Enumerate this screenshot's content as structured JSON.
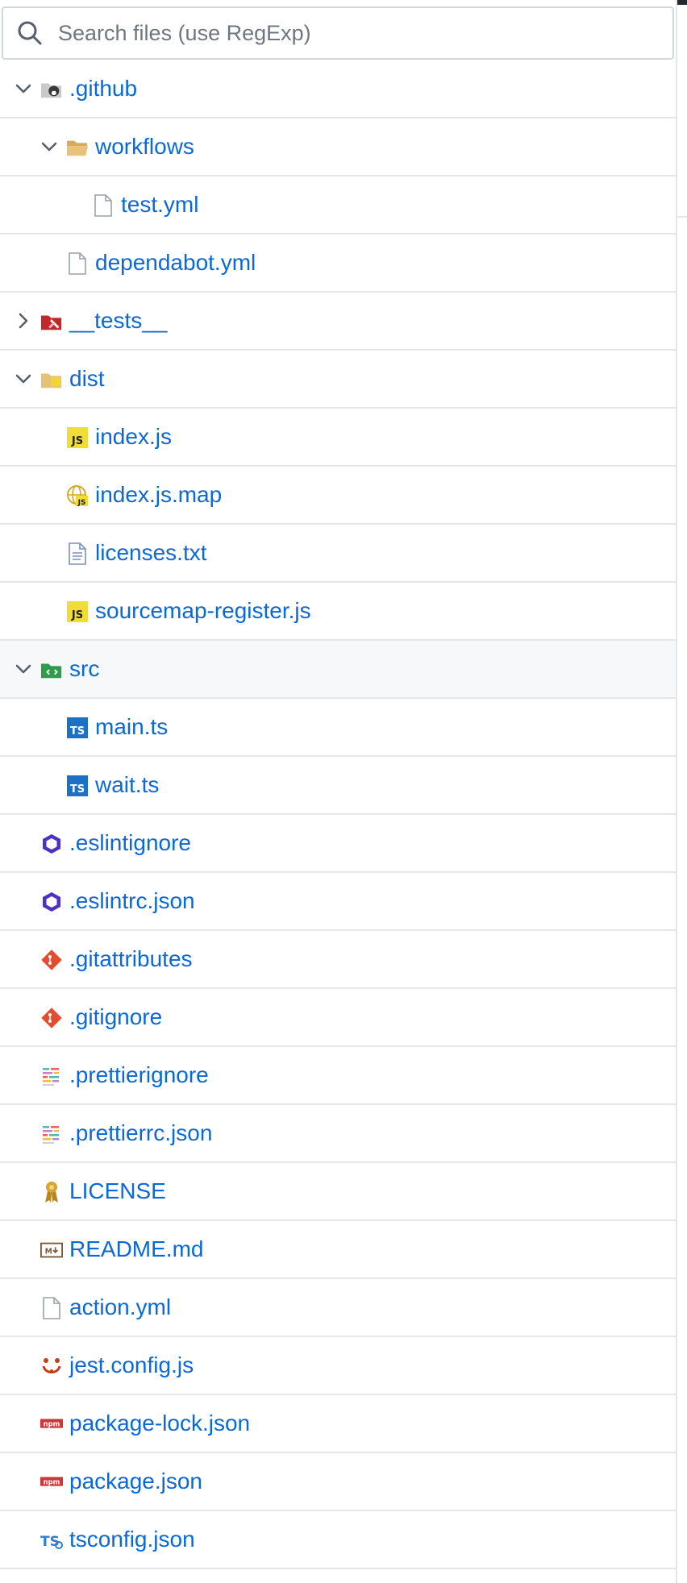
{
  "search": {
    "placeholder": "Search files (use RegExp)"
  },
  "tree": [
    {
      "name": ".github",
      "icon": "github-folder-icon",
      "depth": 0,
      "chevron": "expanded"
    },
    {
      "name": "workflows",
      "icon": "folder-open-icon",
      "depth": 1,
      "chevron": "expanded"
    },
    {
      "name": "test.yml",
      "icon": "file-icon",
      "depth": 2,
      "chevron": "none"
    },
    {
      "name": "dependabot.yml",
      "icon": "file-icon",
      "depth": 1,
      "chevron": "none"
    },
    {
      "name": "__tests__",
      "icon": "test-folder-icon",
      "depth": 0,
      "chevron": "collapsed"
    },
    {
      "name": "dist",
      "icon": "dist-folder-icon",
      "depth": 0,
      "chevron": "expanded"
    },
    {
      "name": "index.js",
      "icon": "javascript-icon",
      "depth": 1,
      "chevron": "none"
    },
    {
      "name": "index.js.map",
      "icon": "javascript-map-icon",
      "depth": 1,
      "chevron": "none"
    },
    {
      "name": "licenses.txt",
      "icon": "text-file-icon",
      "depth": 1,
      "chevron": "none"
    },
    {
      "name": "sourcemap-register.js",
      "icon": "javascript-icon",
      "depth": 1,
      "chevron": "none"
    },
    {
      "name": "src",
      "icon": "src-folder-icon",
      "depth": 0,
      "chevron": "expanded",
      "selected": true
    },
    {
      "name": "main.ts",
      "icon": "typescript-icon",
      "depth": 1,
      "chevron": "none"
    },
    {
      "name": "wait.ts",
      "icon": "typescript-icon",
      "depth": 1,
      "chevron": "none"
    },
    {
      "name": ".eslintignore",
      "icon": "eslint-icon",
      "depth": 0,
      "chevron": "none"
    },
    {
      "name": ".eslintrc.json",
      "icon": "eslint-icon",
      "depth": 0,
      "chevron": "none"
    },
    {
      "name": ".gitattributes",
      "icon": "git-icon",
      "depth": 0,
      "chevron": "none"
    },
    {
      "name": ".gitignore",
      "icon": "git-icon",
      "depth": 0,
      "chevron": "none"
    },
    {
      "name": ".prettierignore",
      "icon": "prettier-icon",
      "depth": 0,
      "chevron": "none"
    },
    {
      "name": ".prettierrc.json",
      "icon": "prettier-icon",
      "depth": 0,
      "chevron": "none"
    },
    {
      "name": "LICENSE",
      "icon": "license-icon",
      "depth": 0,
      "chevron": "none"
    },
    {
      "name": "README.md",
      "icon": "markdown-icon",
      "depth": 0,
      "chevron": "none"
    },
    {
      "name": "action.yml",
      "icon": "file-icon",
      "depth": 0,
      "chevron": "none"
    },
    {
      "name": "jest.config.js",
      "icon": "jest-icon",
      "depth": 0,
      "chevron": "none"
    },
    {
      "name": "package-lock.json",
      "icon": "npm-icon",
      "depth": 0,
      "chevron": "none"
    },
    {
      "name": "package.json",
      "icon": "npm-icon",
      "depth": 0,
      "chevron": "none"
    },
    {
      "name": "tsconfig.json",
      "icon": "tsconfig-icon",
      "depth": 0,
      "chevron": "none"
    }
  ],
  "colors": {
    "link": "#0969da",
    "border": "#e4e6e8",
    "selected_row": "#f6f8fa",
    "chevron": "#57606a"
  }
}
